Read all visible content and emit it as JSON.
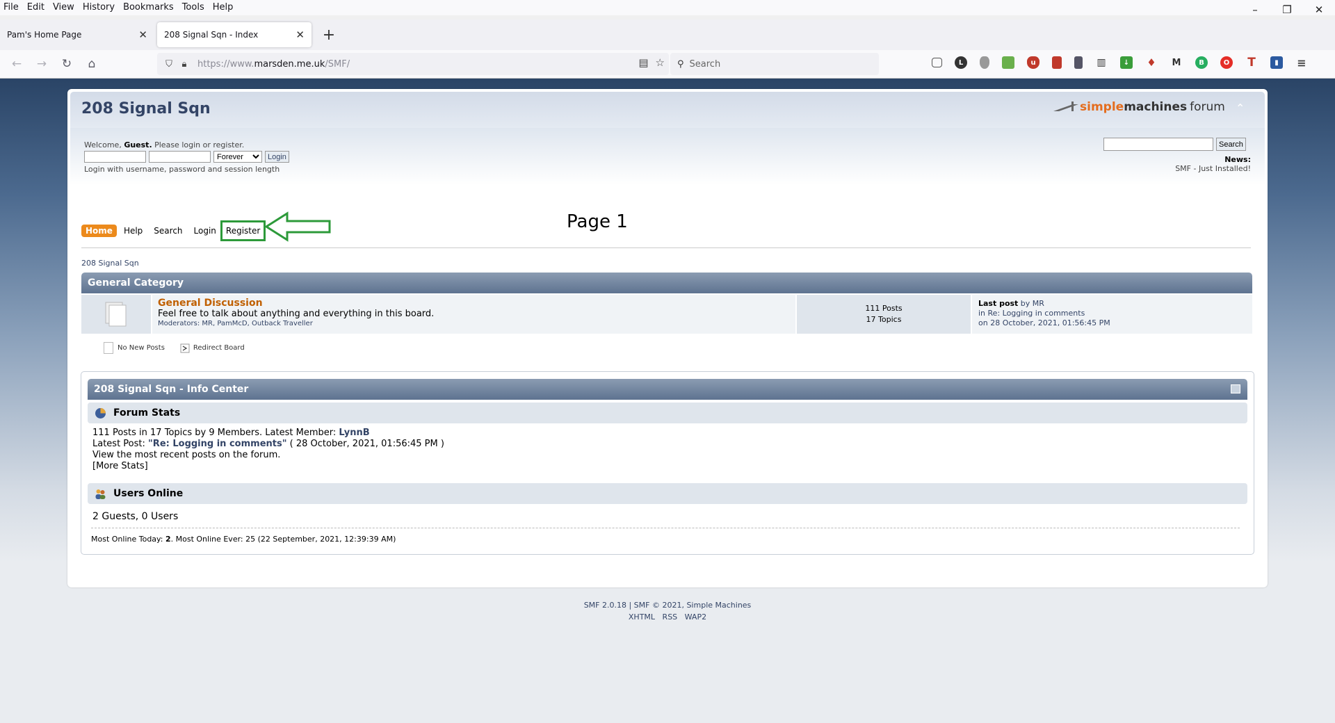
{
  "browser": {
    "menu": [
      "File",
      "Edit",
      "View",
      "History",
      "Bookmarks",
      "Tools",
      "Help"
    ],
    "window_controls": {
      "minimize": "–",
      "restore": "❐",
      "close": "✕"
    },
    "tabs": [
      {
        "title": "Pam's Home Page",
        "active": false
      },
      {
        "title": "208 Signal Sqn - Index",
        "active": true
      }
    ],
    "url": {
      "scheme": "https://www.",
      "host": "marsden.me.uk",
      "path": "/SMF/"
    },
    "search_placeholder": "Search",
    "extensions": [
      "pocket-icon",
      "lastpass-icon",
      "shield-ext-icon",
      "frog-icon",
      "ublock-icon",
      "pdf-icon",
      "list-ext-icon",
      "piano-icon",
      "download-badge-icon",
      "pin-icon",
      "m-icon",
      "b-plus-icon",
      "opera-icon",
      "t-icon",
      "flag-icon",
      "hamburger-menu-icon"
    ]
  },
  "forum": {
    "title": "208 Signal Sqn",
    "logo": {
      "part1": "simple",
      "part2": "machines",
      "part3": "forum"
    },
    "welcome_prefix": "Welcome, ",
    "welcome_guest": "Guest.",
    "welcome_suffix": " Please login or register.",
    "session_option": "Forever",
    "login_button": "Login",
    "login_hint": "Login with username, password and session length",
    "search_button": "Search",
    "news_label": "News:",
    "news_text": "SMF - Just Installed!",
    "menu": [
      "Home",
      "Help",
      "Search",
      "Login",
      "Register"
    ],
    "annotation_page": "Page 1",
    "linktree": "208 Signal Sqn",
    "category": "General Category",
    "board": {
      "name": "General Discussion",
      "description": "Feel free to talk about anything and everything in this board.",
      "moderators": "Moderators: MR, PamMcD, Outback Traveller",
      "posts": "111 Posts",
      "topics": "17 Topics",
      "last_post_label": "Last post",
      "last_post_by": " by MR",
      "last_post_in": "in Re: Logging in comments",
      "last_post_on": "on 28 October, 2021, 01:56:45 PM"
    },
    "legend": {
      "no_new": "No New Posts",
      "redirect": "Redirect Board"
    },
    "info_center": {
      "title": "208 Signal Sqn - Info Center",
      "stats_heading": "Forum Stats",
      "stats_line1_prefix": "111 Posts in 17 Topics by 9 Members. Latest Member: ",
      "latest_member": "LynnB",
      "stats_line2_prefix": "Latest Post: ",
      "latest_post": "\"Re: Logging in comments\"",
      "stats_line2_suffix": " ( 28 October, 2021, 01:56:45 PM )",
      "stats_line3": "View the most recent posts on the forum.",
      "stats_line4": "[More Stats]",
      "online_heading": "Users Online",
      "online_text": "2 Guests, 0 Users",
      "most_online_prefix": "Most Online Today: ",
      "most_online_today": "2",
      "most_online_suffix": ". Most Online Ever: 25 (22 September, 2021, 12:39:39 AM)"
    },
    "footer": {
      "line1": "SMF 2.0.18 | SMF © 2021, Simple Machines",
      "links": [
        "XHTML",
        "RSS",
        "WAP2"
      ]
    }
  },
  "colors": {
    "accent": "#ec8a1c",
    "annotation": "#2d9a3a",
    "link": "#334466",
    "board_title": "#c06002"
  }
}
